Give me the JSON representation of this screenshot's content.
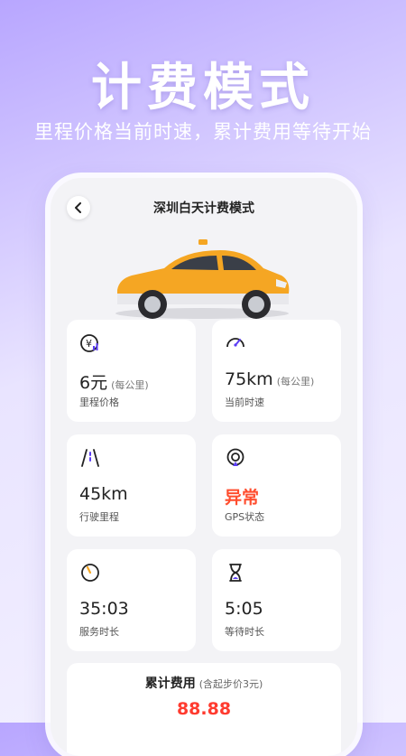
{
  "promo": {
    "title": "计费模式",
    "subtitle": "里程价格当前时速，累计费用等待开始"
  },
  "screen": {
    "title": "深圳白天计费模式"
  },
  "cards": {
    "price": {
      "value": "6元",
      "unit": "(每公里)",
      "label": "里程价格",
      "icon": "yuan-signal-icon"
    },
    "speed": {
      "value": "75km",
      "unit": "(每公里)",
      "label": "当前时速",
      "icon": "speedometer-icon"
    },
    "distance": {
      "value": "45km",
      "label": "行驶里程",
      "icon": "road-icon"
    },
    "gps": {
      "value": "异常",
      "label": "GPS状态",
      "icon": "gps-icon"
    },
    "service_time": {
      "value": "35:03",
      "label": "服务时长",
      "icon": "clock-icon"
    },
    "wait_time": {
      "value": "5:05",
      "label": "等待时长",
      "icon": "hourglass-icon"
    }
  },
  "total": {
    "title": "累计费用",
    "note": "(含起步价3元)",
    "value": "88.88"
  },
  "colors": {
    "accent": "#5b3df5",
    "warning": "#ff4d2e",
    "taxi": "#f5a623"
  }
}
